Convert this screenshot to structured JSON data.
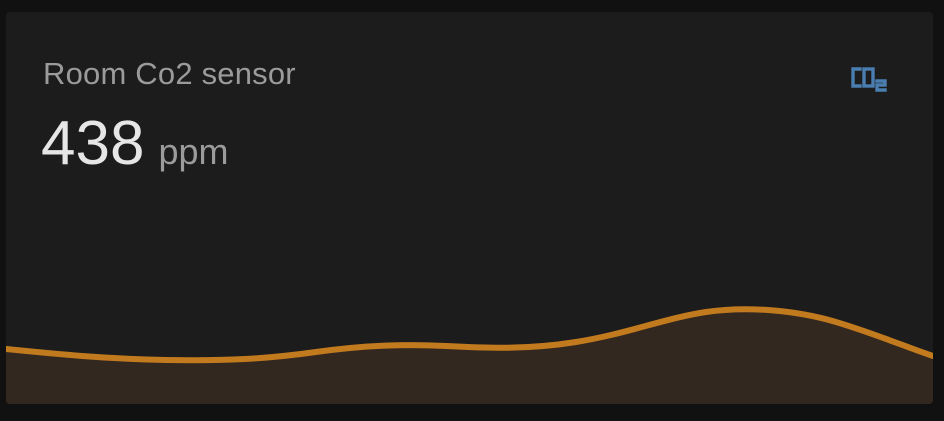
{
  "card": {
    "title": "Room Co2 sensor",
    "value": "438",
    "unit": "ppm",
    "icon": "molecule-co2-icon",
    "accent_color": "#4a7eb0"
  },
  "graph": {
    "line_color": "#c27a1e",
    "fill_color": "#33281f"
  }
}
